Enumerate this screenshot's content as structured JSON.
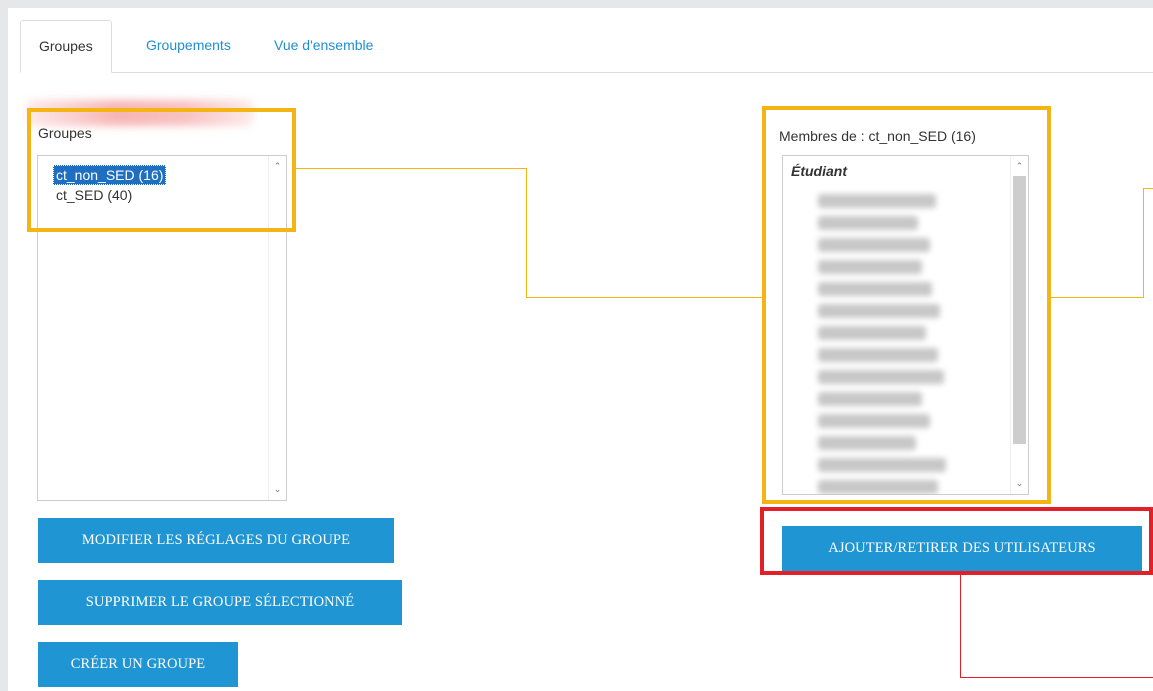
{
  "tabs": [
    {
      "label": "Groupes",
      "active": true
    },
    {
      "label": "Groupements",
      "active": false
    },
    {
      "label": "Vue d'ensemble",
      "active": false
    }
  ],
  "groups": {
    "label": "Groupes",
    "items": [
      {
        "label": "ct_non_SED (16)",
        "selected": true
      },
      {
        "label": "ct_SED (40)",
        "selected": false
      }
    ]
  },
  "members": {
    "label": "Membres de : ct_non_SED (16)",
    "role_heading": "Étudiant",
    "redacted_count": 15
  },
  "buttons": {
    "edit_group": "MODIFIER LES RÉGLAGES DU GROUPE",
    "delete_group": "SUPPRIMER LE GROUPE SÉLECTIONNÉ",
    "create_group": "CRÉER UN GROUPE",
    "add_remove_users": "AJOUTER/RETIRER DES UTILISATEURS"
  },
  "colors": {
    "accent": "#1f96d3",
    "highlight_yellow": "#f4b414",
    "highlight_red": "#e32028",
    "selection": "#1e6fc2"
  },
  "icons": {
    "scroll_up": "chevron-up-icon",
    "scroll_down": "chevron-down-icon"
  }
}
